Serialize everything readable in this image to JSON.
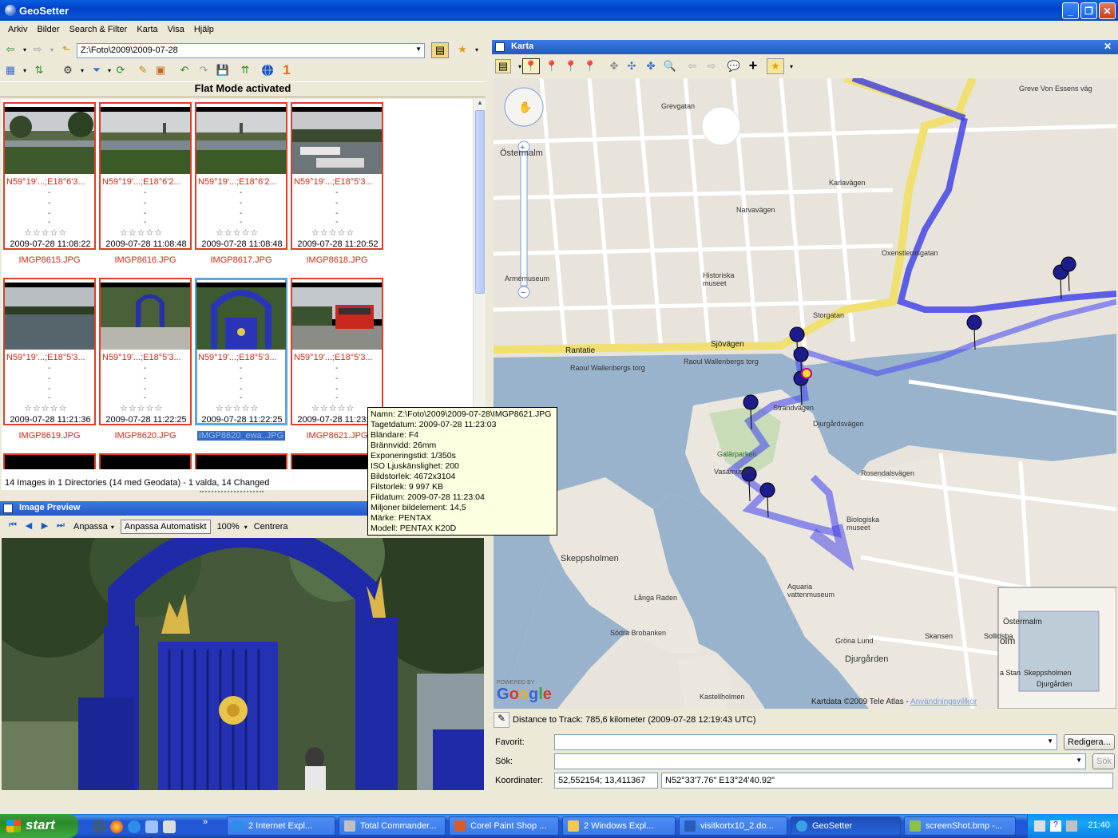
{
  "window": {
    "title": "GeoSetter"
  },
  "menu": [
    "Arkiv",
    "Bilder",
    "Search & Filter",
    "Karta",
    "Visa",
    "Hjälp"
  ],
  "browser": {
    "path": "Z:\\Foto\\2009\\2009-07-28",
    "flat_mode": "Flat Mode activated",
    "thumbnails": [
      {
        "coord": "N59°19'...;E18°6'3...",
        "date": "2009-07-28 11:08:22",
        "file": "IMGP8615.JPG",
        "scene": "lake",
        "selected": false
      },
      {
        "coord": "N59°19'...;E18°6'2...",
        "date": "2009-07-28 11:08:48",
        "file": "IMGP8616.JPG",
        "scene": "lake",
        "selected": false
      },
      {
        "coord": "N59°19'...;E18°6'2...",
        "date": "2009-07-28 11:08:48",
        "file": "IMGP8617.JPG",
        "scene": "lake",
        "selected": false
      },
      {
        "coord": "N59°19'...;E18°5'3...",
        "date": "2009-07-28 11:20:52",
        "file": "IMGP8618.JPG",
        "scene": "harbor",
        "selected": false
      },
      {
        "coord": "N59°19'...;E18°5'3...",
        "date": "2009-07-28 11:21:36",
        "file": "IMGP8619.JPG",
        "scene": "water",
        "selected": false
      },
      {
        "coord": "N59°19'...;E18°5'3...",
        "date": "2009-07-28 11:22:25",
        "file": "IMGP8620.JPG",
        "scene": "gate-far",
        "selected": false
      },
      {
        "coord": "N59°19'...;E18°5'3...",
        "date": "2009-07-28 11:22:25",
        "file": "IMGP8620_ewa..JPG",
        "scene": "gate",
        "selected": true
      },
      {
        "coord": "N59°19'...;E18°5'3...",
        "date": "2009-07-28 11:23:03",
        "file": "IMGP8621.JPG",
        "scene": "tram",
        "selected": false
      }
    ],
    "status": "14 Images in 1 Directories (14 med Geodata) - 1 valda, 14 Changed"
  },
  "preview": {
    "title": "Image Preview",
    "fit_label": "Anpassa",
    "auto_fit_label": "Anpassa Automatiskt",
    "zoom": "100%",
    "center_label": "Centrera"
  },
  "tooltip": [
    "Namn: Z:\\Foto\\2009\\2009-07-28\\IMGP8621.JPG",
    "Tagetdatum: 2009-07-28 11:23:03",
    "Bländare: F4",
    "Brännvidd: 26mm",
    "Exponeringstid: 1/350s",
    "ISO Ljuskänslighet: 200",
    "Bildstorlek: 4672x3104",
    "Filstorlek: 9 997 KB",
    "Fildatum: 2009-07-28 11:23:04",
    "Miljoner bildelement: 14,5",
    "Märke: PENTAX",
    "Modell: PENTAX K20D"
  ],
  "map": {
    "title": "Karta",
    "labels": {
      "ostermalm": "Östermalm",
      "rantatie": "Rantatie",
      "sjovagen": "Sjövägen",
      "raoul1": "Raoul Wallenbergs torg",
      "raoul2": "Raoul Wallenbergs torg",
      "galarparken": "Galärparken",
      "vasamuseet": "Vasamuseet",
      "skeppsholmen": "Skeppsholmen",
      "djurgarden": "Djurgården",
      "rosendalsvagen": "Rosendalsvägen",
      "biologiska": "Biologiska museet",
      "aquaria": "Aquaria vattenmuseum",
      "langa_raden": "Långa Raden",
      "sodra_brobanken": "Södra Brobanken",
      "kastellholmen": "Kastellholmen",
      "skansen": "Skansen",
      "grona_lund": "Gröna Lund",
      "historiska": "Historiska museet",
      "armemuseum": "Armémuseum",
      "storgatan": "Storgatan",
      "karlavagen": "Karlavägen",
      "grevgatan": "Grevgatan",
      "narvavagen": "Narvavägen",
      "strandvagen": "Strandvägen",
      "djurgardsvagen": "Djurgårdsvägen",
      "gravens": "Greve Von Essens väg",
      "oxenstierna": "Oxenstiernsgatan"
    },
    "powered_by": "POWERED BY",
    "google": "Google",
    "copyright": "Kartdata ©2009 Tele Atlas -",
    "terms": "Användningsvillkor",
    "mini_labels": {
      "ostermalm": "Östermalm",
      "skeppsholmen": "Skeppsholmen",
      "djurgarden": "Djurgården",
      "olm": "olm",
      "a_stan": "a Stan",
      "sollidsba": "Sollidsba"
    }
  },
  "distance": "Distance to Track: 785,6 kilometer (2009-07-28 12:19:43 UTC)",
  "form": {
    "favorit_label": "Favorit:",
    "favorit_value": "",
    "edit_button": "Redigera...",
    "search_label": "Sök:",
    "search_value": "",
    "search_button": "Sök",
    "coords_label": "Koordinater:",
    "coords_decimal": "52,552154; 13,411367",
    "coords_dms": "N52°33'7.76\" E13°24'40.92\""
  },
  "taskbar": {
    "start": "start",
    "tasks": [
      {
        "label": "2 Internet Expl...",
        "color": "#2d8ee8"
      },
      {
        "label": "Total Commander...",
        "color": "#c0c0c0"
      },
      {
        "label": "Corel Paint Shop ...",
        "color": "#d85c2a"
      },
      {
        "label": "2 Windows Expl...",
        "color": "#f2c94c"
      },
      {
        "label": "visitkortx10_2.do...",
        "color": "#2a5db5"
      },
      {
        "label": "GeoSetter",
        "color": "#3aa0e8"
      },
      {
        "label": "screenShot.bmp -...",
        "color": "#8bc34a"
      }
    ],
    "clock": "21:40"
  }
}
